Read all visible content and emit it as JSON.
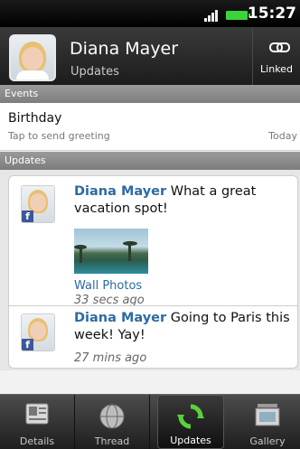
{
  "status": {
    "time": "15:27",
    "icons": [
      "signal-icon",
      "battery-icon"
    ]
  },
  "contact": {
    "name": "Diana Mayer",
    "subtitle": "Updates",
    "linked_label": "Linked"
  },
  "events": {
    "header": "Events",
    "item": {
      "title": "Birthday",
      "subtitle": "Tap to send greeting",
      "date": "Today"
    }
  },
  "updates": {
    "header": "Updates",
    "posts": [
      {
        "author": "Diana Mayer",
        "text": "What a great vacation spot!",
        "attachment_label": "Wall Photos",
        "time": "33 secs ago",
        "source_icon": "facebook-icon"
      },
      {
        "author": "Diana Mayer",
        "text": "Going to Paris this week! Yay!",
        "time": "27 mins ago",
        "source_icon": "facebook-icon"
      }
    ]
  },
  "tabs": [
    {
      "label": "Details",
      "icon": "contact-card-icon"
    },
    {
      "label": "Thread",
      "icon": "globe-icon"
    },
    {
      "label": "Updates",
      "icon": "refresh-icon",
      "active": true
    },
    {
      "label": "Gallery",
      "icon": "gallery-icon"
    }
  ],
  "colors": {
    "author_blue": "#2d6aa3",
    "facebook": "#3b5998",
    "battery": "#3bd43b"
  }
}
